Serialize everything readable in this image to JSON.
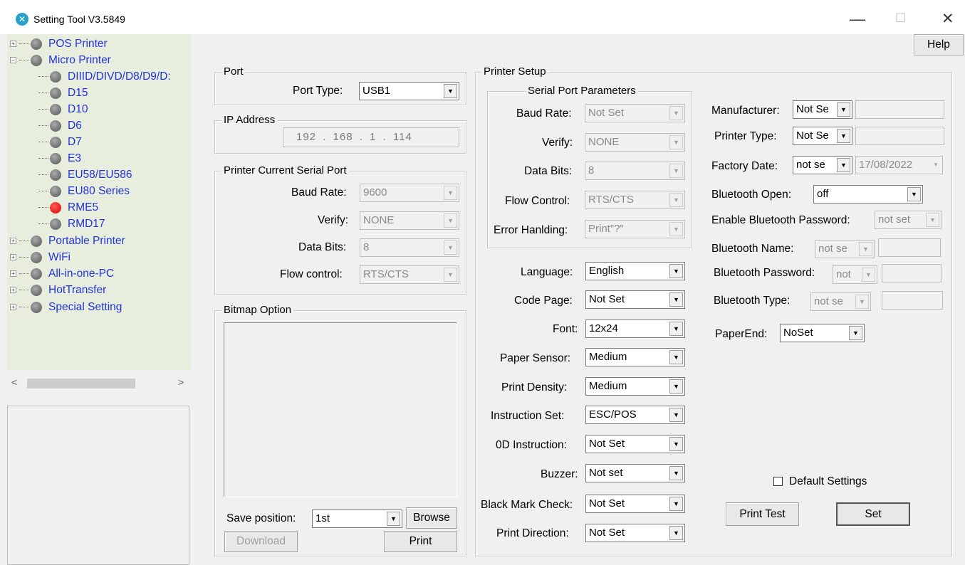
{
  "window": {
    "title": "Setting Tool V3.5849",
    "minimize": "—",
    "maximize": "☐",
    "close": "✕"
  },
  "help": "Help",
  "tree": {
    "items": [
      "POS Printer",
      "Micro Printer",
      "DIIID/DIVD/D8/D9/D:",
      "D15",
      "D10",
      "D6",
      "D7",
      "E3",
      "EU58/EU586",
      "EU80 Series",
      "RME5",
      "RMD17",
      "Portable Printer",
      "WiFi",
      "All-in-one-PC",
      "HotTransfer",
      "Special Setting"
    ]
  },
  "port": {
    "title": "Port",
    "port_type_label": "Port Type:",
    "port_type_value": "USB1"
  },
  "ip": {
    "title": "IP Address",
    "value": "192 . 168 . 1 . 114"
  },
  "serial": {
    "title": "Printer Current Serial Port",
    "baud_label": "Baud Rate:",
    "baud_value": "9600",
    "verify_label": "Verify:",
    "verify_value": "NONE",
    "databits_label": "Data Bits:",
    "databits_value": "8",
    "flow_label": "Flow control:",
    "flow_value": "RTS/CTS"
  },
  "bitmap": {
    "title": "Bitmap Option",
    "save_label": "Save position:",
    "save_value": "1st",
    "browse": "Browse",
    "download": "Download",
    "print": "Print"
  },
  "setup": {
    "title": "Printer Setup",
    "sp_title": "Serial Port Parameters",
    "sp": [
      {
        "label": "Baud Rate:",
        "value": "Not Set"
      },
      {
        "label": "Verify:",
        "value": "NONE"
      },
      {
        "label": "Data Bits:",
        "value": "8"
      },
      {
        "label": "Flow Control:",
        "value": "RTS/CTS"
      },
      {
        "label": "Error Hanlding:",
        "value": "Print\"?\""
      }
    ],
    "params": [
      {
        "label": "Language:",
        "value": "English"
      },
      {
        "label": "Code Page:",
        "value": "Not Set"
      },
      {
        "label": "Font:",
        "value": "12x24"
      },
      {
        "label": "Paper Sensor:",
        "value": "Medium"
      },
      {
        "label": "Print Density:",
        "value": "Medium"
      },
      {
        "label": "Instruction Set:",
        "value": "ESC/POS"
      },
      {
        "label": "0D Instruction:",
        "value": "Not Set"
      },
      {
        "label": "Buzzer:",
        "value": "Not set"
      },
      {
        "label": "Black Mark Check:",
        "value": "Not Set"
      },
      {
        "label": "Print Direction:",
        "value": "Not Set"
      }
    ],
    "manufacturer_label": "Manufacturer:",
    "manufacturer_value": "Not Se",
    "printer_type_label": "Printer Type:",
    "printer_type_value": "Not Se",
    "factory_date_label": "Factory Date:",
    "factory_date_value": "not se",
    "factory_date_date": "17/08/2022",
    "bt_open_label": "Bluetooth Open:",
    "bt_open_value": "off",
    "bt_pwd_enable_label": "Enable Bluetooth Password:",
    "bt_pwd_enable_value": "not set",
    "bt_name_label": "Bluetooth Name:",
    "bt_name_value": "not se",
    "bt_pwd_label": "Bluetooth Password:",
    "bt_pwd_value": "not",
    "bt_type_label": "Bluetooth Type:",
    "bt_type_value": "not se",
    "paperend_label": "PaperEnd:",
    "paperend_value": "NoSet",
    "default_settings": "Default Settings",
    "print_test": "Print Test",
    "set": "Set"
  }
}
